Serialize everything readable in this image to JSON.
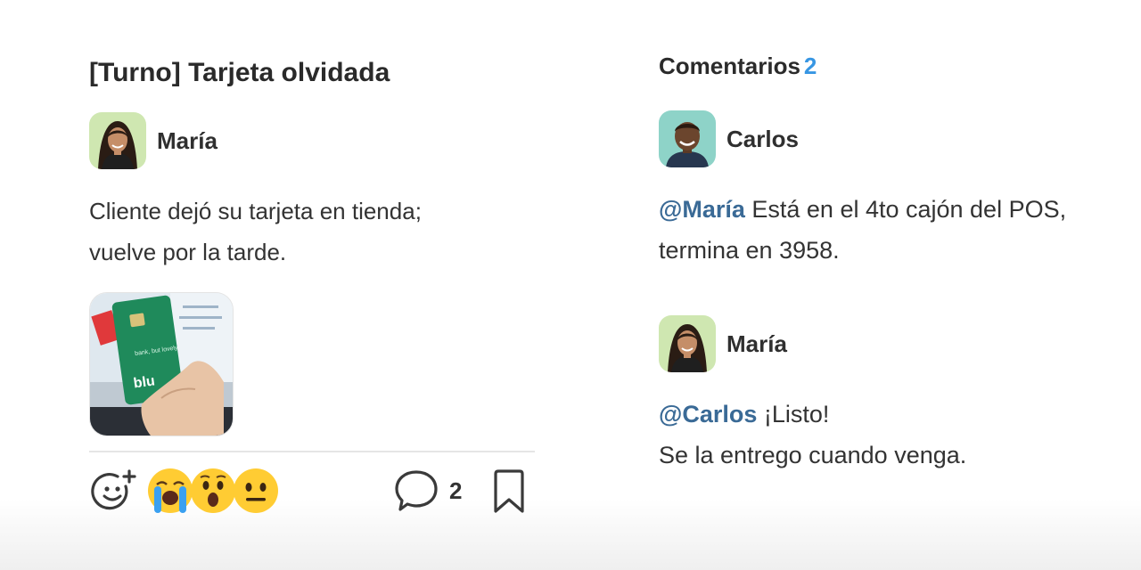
{
  "post": {
    "title": "[Turno] Tarjeta olvidada",
    "author": "María",
    "body_line1": "Cliente dejó su tarjeta en tienda;",
    "body_line2": "vuelve por la tarde.",
    "attachment": {
      "card_tagline": "bank, but lovely.",
      "card_brand": "blu"
    },
    "reactions": [
      {
        "icon": "loudly-crying-face-icon",
        "emoji": "😭"
      },
      {
        "icon": "astonished-face-icon",
        "emoji": "😮"
      },
      {
        "icon": "neutral-face-icon",
        "emoji": "😐"
      }
    ],
    "comment_count": "2",
    "colors": {
      "card": "#1f8a5b",
      "mention": "#3a6a96",
      "count_accent": "#3796e3"
    }
  },
  "comments": {
    "header": "Comentarios",
    "count": "2",
    "items": [
      {
        "author": "Carlos",
        "mention": "@María",
        "text_line1": " Está en el 4to cajón del POS,",
        "text_line2": "termina en 3958."
      },
      {
        "author": "María",
        "mention": "@Carlos",
        "text_line1": " ¡Listo!",
        "text_line2": "Se la entrego cuando venga."
      }
    ]
  }
}
